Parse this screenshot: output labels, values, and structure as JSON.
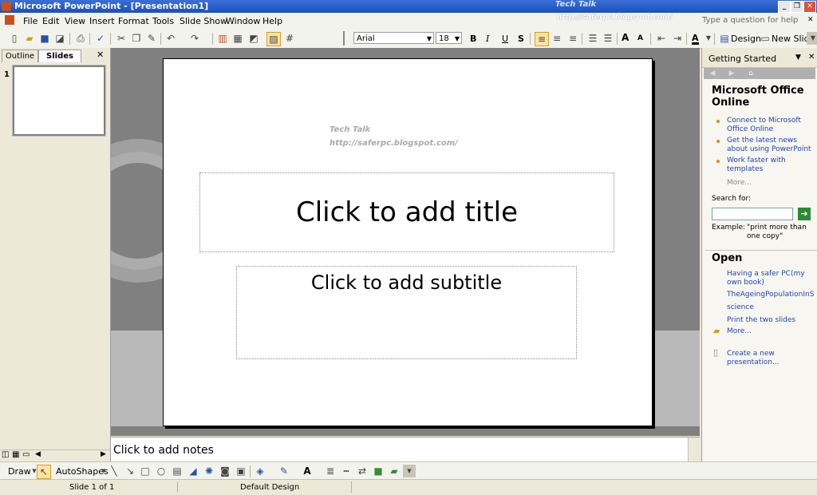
{
  "window": {
    "title": "Microsoft PowerPoint - [Presentation1]",
    "watermark_title": "Tech Talk",
    "watermark_url": "http://saferpc.blogspot.com/"
  },
  "menu": [
    "File",
    "Edit",
    "View",
    "Insert",
    "Format",
    "Tools",
    "Slide Show",
    "Window",
    "Help"
  ],
  "help_placeholder": "Type a question for help",
  "toolbar": {
    "font_name": "Arial",
    "font_size": "18",
    "bold": "B",
    "italic": "I",
    "underline": "U",
    "shadow": "S",
    "font_color_glyph": "A",
    "increase_font": "A",
    "decrease_font": "A",
    "design_label": "Design",
    "new_slide_label": "New Slide"
  },
  "left_pane": {
    "tab_outline": "Outline",
    "tab_slides": "Slides",
    "close_glyph": "✕",
    "slide_number": "1"
  },
  "slide": {
    "title_placeholder": "Click to add title",
    "subtitle_placeholder": "Click to add subtitle",
    "watermark_line1": "Tech Talk",
    "watermark_line2": "http://saferpc.blogspot.com/"
  },
  "notes_placeholder": "Click to add notes",
  "task_pane": {
    "title": "Getting Started",
    "section_online": "Microsoft Office Online",
    "links_online": [
      "Connect to Microsoft Office Online",
      "Get the latest news about using PowerPoint",
      "Work faster with templates"
    ],
    "more_online": "More...",
    "search_label": "Search for:",
    "example_label": "Example:",
    "example_text": "\"print more than one copy\"",
    "section_open": "Open",
    "open_files": [
      "Having a safer PC(my own book)",
      "TheAgeingPopulationInSingapore",
      "science",
      "Print the two slides"
    ],
    "more_open": "More...",
    "create_new": "Create a new presentation..."
  },
  "drawbar": {
    "draw_label": "Draw",
    "autoshapes_label": "AutoShapes"
  },
  "status": {
    "slide_info": "Slide 1 of 1",
    "design": "Default Design"
  }
}
